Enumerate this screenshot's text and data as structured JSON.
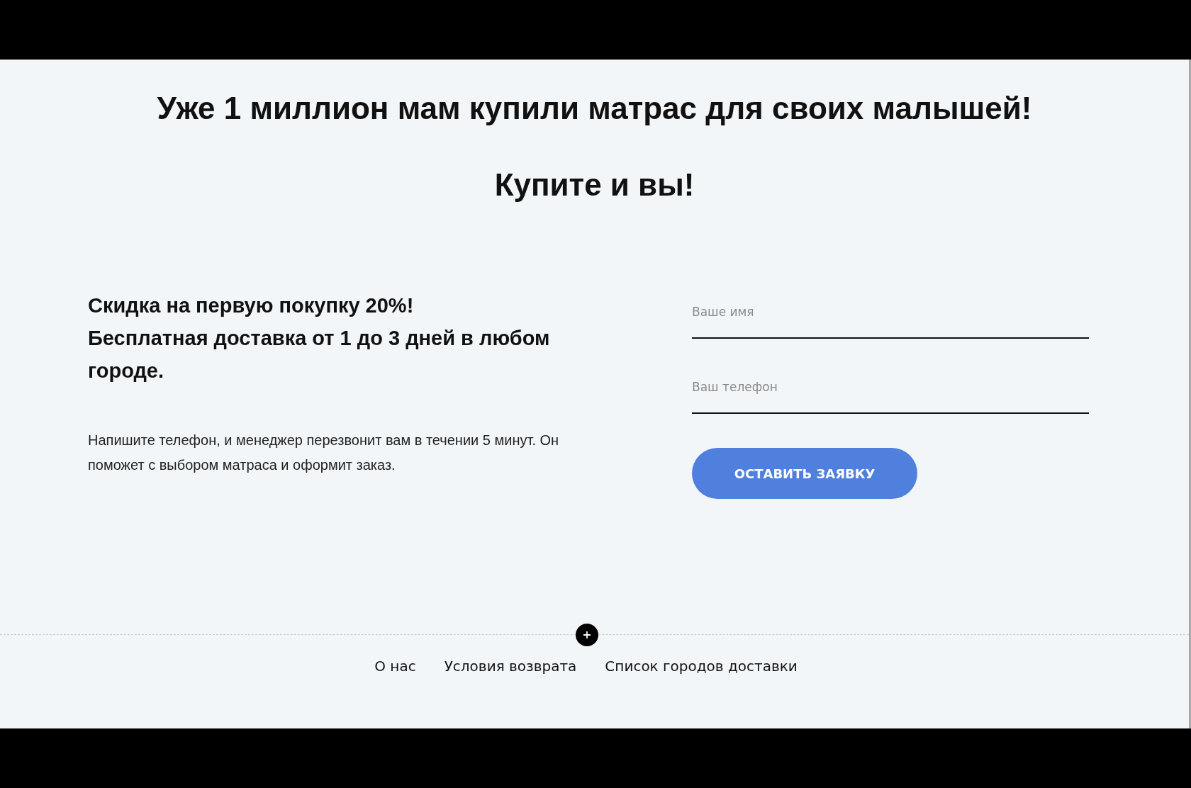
{
  "headline": "Уже 1 миллион мам купили матрас для своих малышей!",
  "subheadline": "Купите и вы!",
  "offer": {
    "title_lines": [
      "Скидка на первую покупку 20%!",
      "Бесплатная доставка от 1 до 3 дней в любом городе."
    ],
    "description": "Напишите телефон, и менеджер перезвонит вам в течении 5 минут. Он поможет с выбором матраса и оформит заказ."
  },
  "form": {
    "fields": [
      {
        "placeholder": "Ваше имя"
      },
      {
        "placeholder": "Ваш телефон"
      }
    ],
    "submit": "ОСТАВИТЬ ЗАЯВКУ"
  },
  "footer": {
    "links": [
      "О нас",
      "Условия возврата",
      "Список городов доставки"
    ]
  }
}
